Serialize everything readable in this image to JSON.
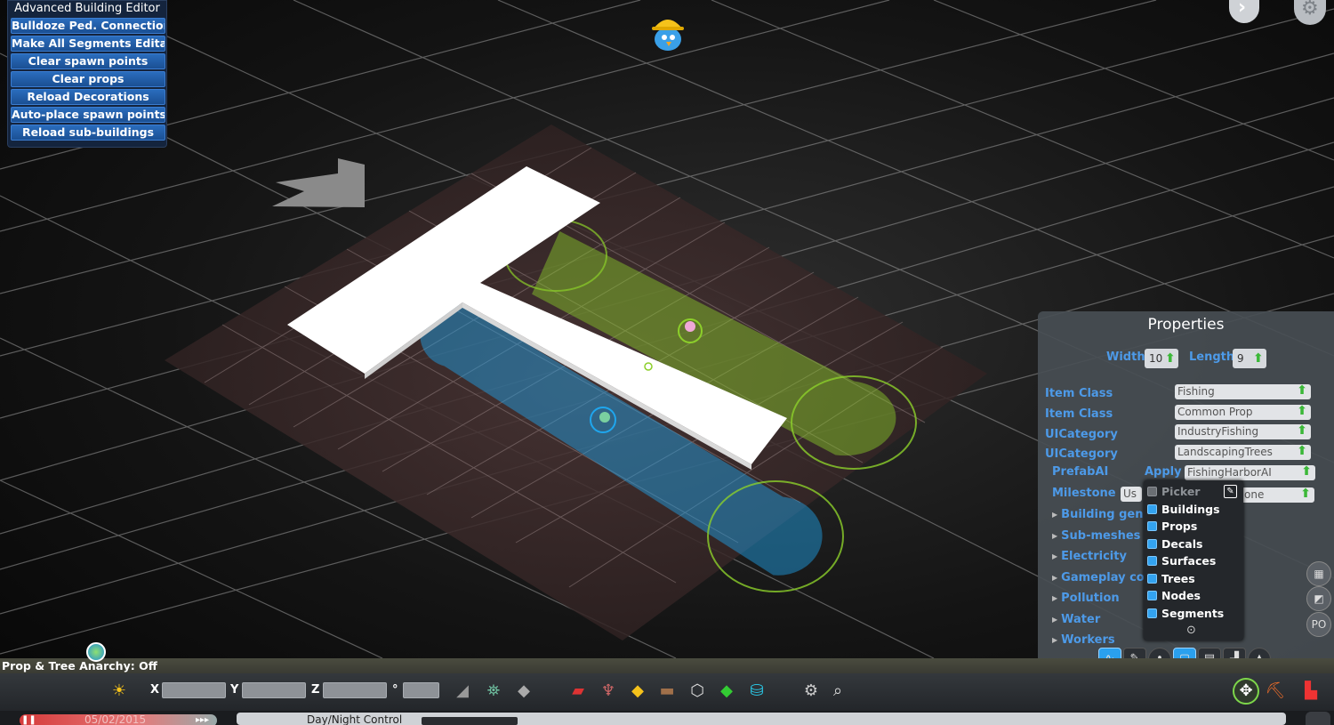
{
  "editor_panel": {
    "title": "Advanced Building Editor",
    "buttons": [
      "Bulldoze Ped. Connections",
      "Make All Segments Editabl",
      "Clear spawn points",
      "Clear props",
      "Reload Decorations",
      "Auto-place spawn points",
      "Reload sub-buildings"
    ]
  },
  "properties": {
    "title": "Properties",
    "width_label": "Width",
    "width_value": "10",
    "length_label": "Length",
    "length_value": "9",
    "rows": [
      {
        "label": "Item Class",
        "value": "Fishing"
      },
      {
        "label": "Item Class",
        "value": "Common Prop"
      },
      {
        "label": "UICategory",
        "value": "IndustryFishing"
      },
      {
        "label": "UICategory",
        "value": "LandscapingTrees"
      }
    ],
    "prefab_ai_label": "PrefabAI",
    "apply_label": "Apply",
    "prefab_ai_value": "FishingHarborAI",
    "milestone_label": "Milestone",
    "milestone_partial_left": "Us",
    "milestone_partial_right": "one",
    "sections": [
      "Building gener",
      "Sub-meshes",
      "Electricity",
      "Gameplay cor",
      "Pollution",
      "Water",
      "Workers"
    ]
  },
  "picker": {
    "items": [
      {
        "label": "Picker",
        "enabled": false
      },
      {
        "label": "Buildings",
        "enabled": true
      },
      {
        "label": "Props",
        "enabled": true
      },
      {
        "label": "Decals",
        "enabled": true
      },
      {
        "label": "Surfaces",
        "enabled": true
      },
      {
        "label": "Trees",
        "enabled": true
      },
      {
        "label": "Nodes",
        "enabled": true
      },
      {
        "label": "Segments",
        "enabled": true
      }
    ]
  },
  "anarchy": {
    "text": "Prop & Tree Anarchy: Off"
  },
  "toolbar": {
    "x_label": "X",
    "y_label": "Y",
    "z_label": "Z",
    "deg_label": "°"
  },
  "infobar": {
    "date": "05/02/2015",
    "daynight_label": "Day/Night Control"
  },
  "side_icons": [
    "grid-icon",
    "surface-icon",
    "po-icon"
  ],
  "side_po_label": "PO",
  "colors": {
    "accent_blue": "#4d9ae8",
    "button_blue": "#2a6dbd",
    "green_arrow": "#3bb838",
    "path_blue": "#1fa6ee",
    "path_green": "#8ccf2a"
  }
}
